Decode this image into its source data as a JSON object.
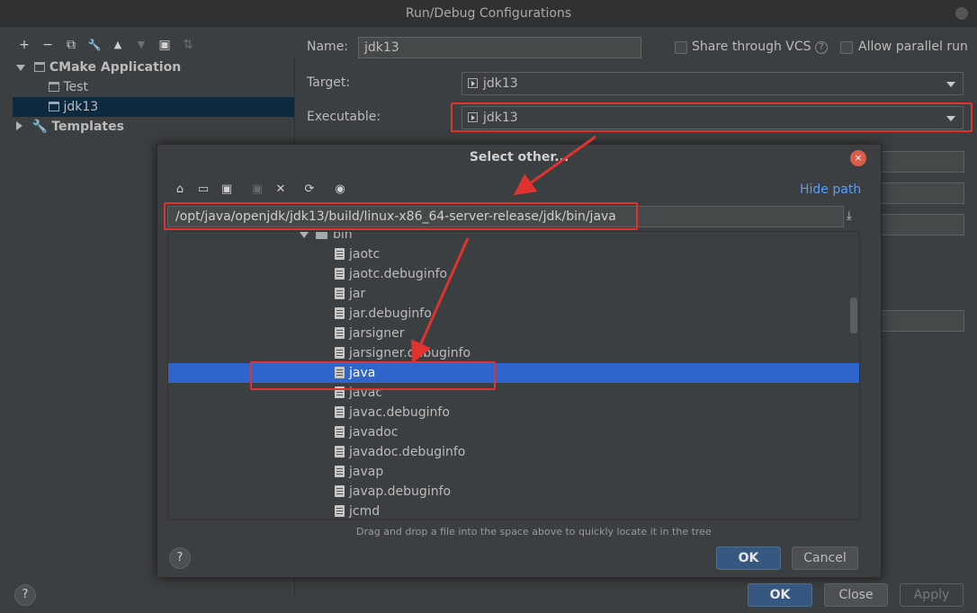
{
  "window": {
    "title": "Run/Debug Configurations"
  },
  "toolbar": {
    "add": "+",
    "remove": "−",
    "copy": "⧉",
    "edit": "🔧",
    "up": "▲",
    "down": "▼",
    "folder": "▣",
    "sort": "⇅"
  },
  "tree": {
    "group_label": "CMake Application",
    "items": [
      {
        "label": "Test"
      },
      {
        "label": "jdk13"
      }
    ],
    "templates_label": "Templates"
  },
  "form": {
    "name_label": "Name:",
    "name_value": "jdk13",
    "share_vcs_label": "Share through VCS",
    "allow_parallel_label": "Allow parallel run",
    "target_label": "Target:",
    "target_value": "jdk13",
    "executable_label": "Executable:",
    "executable_value": "jdk13"
  },
  "dialog": {
    "title": "Select other...",
    "close_glyph": "×",
    "hide_path_label": "Hide path",
    "path_value": "/opt/java/openjdk/jdk13/build/linux-x86_64-server-release/jdk/bin/java",
    "folder_label": "bin",
    "files": [
      "jaotc",
      "jaotc.debuginfo",
      "jar",
      "jar.debuginfo",
      "jarsigner",
      "jarsigner.debuginfo",
      "java",
      "javac",
      "javac.debuginfo",
      "javadoc",
      "javadoc.debuginfo",
      "javap",
      "javap.debuginfo",
      "jcmd"
    ],
    "selected_file": "java",
    "hint": "Drag and drop a file into the space above to quickly locate it in the tree",
    "ok_label": "OK",
    "cancel_label": "Cancel",
    "help_glyph": "?"
  },
  "footer": {
    "ok_label": "OK",
    "close_label": "Close",
    "apply_label": "Apply",
    "help_glyph": "?"
  },
  "colors": {
    "background": "#3c3f41",
    "selection": "#2f65ca",
    "accent_link": "#589df6",
    "annotation_red": "#e0322f",
    "primary_button": "#365880"
  }
}
